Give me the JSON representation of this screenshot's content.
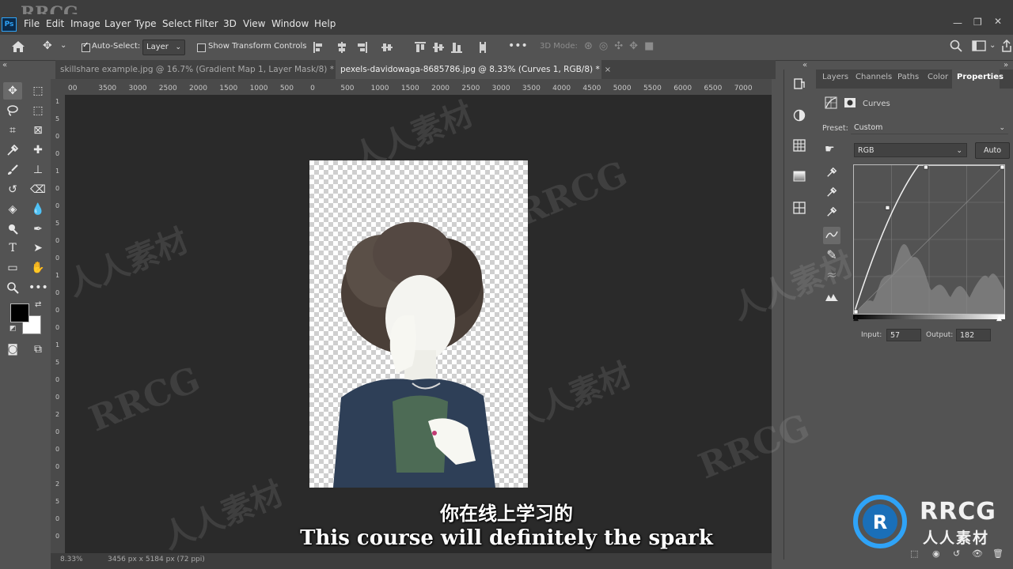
{
  "watermark_top": "RRCG",
  "menu": {
    "logo": "Ps",
    "items": [
      "File",
      "Edit",
      "Image",
      "Layer",
      "Type",
      "Select",
      "Filter",
      "3D",
      "View",
      "Window",
      "Help"
    ]
  },
  "options": {
    "auto_select_label": "Auto-Select:",
    "auto_select_value": "Layer",
    "show_transform_label": "Show Transform Controls",
    "mode_3d_label": "3D Mode:"
  },
  "tabs": [
    {
      "label": "skillshare example.jpg @ 16.7% (Gradient Map 1, Layer Mask/8) *",
      "close": "×"
    },
    {
      "label": "pexels-davidowaga-8685786.jpg @ 8.33% (Curves 1, RGB/8) *",
      "close": "×"
    }
  ],
  "ruler": {
    "h_ticks": [
      "00",
      "3500",
      "3000",
      "2500",
      "2000",
      "1500",
      "1000",
      "500",
      "0",
      "500",
      "1000",
      "1500",
      "2000",
      "2500",
      "3000",
      "3500",
      "4000",
      "4500",
      "5000",
      "5500",
      "6000",
      "6500",
      "7000"
    ],
    "v_ticks": [
      "1",
      "5",
      "0",
      "0",
      "1",
      "0",
      "0",
      "5",
      "0",
      "0",
      "1",
      "0",
      "0",
      "0",
      "1",
      "5",
      "0",
      "0",
      "2",
      "0",
      "0",
      "0",
      "2",
      "5",
      "0",
      "0"
    ]
  },
  "status": {
    "zoom": "8.33%",
    "doc_info": "3456 px x 5184 px (72 ppi)"
  },
  "panel": {
    "tabs": [
      "Layers",
      "Channels",
      "Paths",
      "Color",
      "Properties"
    ],
    "active_tab": "Properties",
    "adjustment_title": "Curves",
    "preset_label": "Preset:",
    "preset_value": "Custom",
    "channel_value": "RGB",
    "auto_label": "Auto",
    "input_label": "Input:",
    "input_value": "57",
    "output_label": "Output:",
    "output_value": "182"
  },
  "curve": {
    "points": [
      [
        0,
        0
      ],
      [
        57,
        182
      ],
      [
        122,
        255
      ],
      [
        255,
        255
      ]
    ]
  },
  "subtitles": {
    "chinese": "你在线上学习的",
    "english": "This course will definitely the spark"
  },
  "logo": {
    "brand": "RRCG",
    "brand_cn": "人人素材"
  },
  "watermarks": [
    "RRCG",
    "人人素材"
  ],
  "colors": {
    "menubar": "#3d3d3d",
    "panel": "#535353",
    "canvas": "#2a2a2a",
    "accent_blue": "#2fa3f7"
  }
}
